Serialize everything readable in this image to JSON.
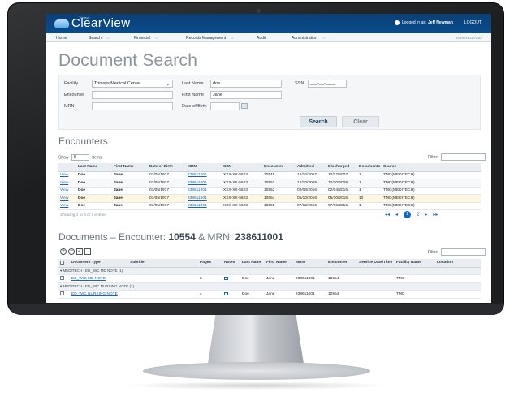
{
  "app": {
    "brand_sub": "Trinisys",
    "brand_name": "ClearView",
    "logged_in_label": "Logged in as:",
    "user_name": "Jeff Newman",
    "logout_label": "LOGOUT",
    "release": "2019 RELEASE"
  },
  "menu": [
    "Home",
    "Search",
    "Financial",
    "Records Management",
    "Audit",
    "Administration"
  ],
  "page": {
    "title": "Document Search"
  },
  "search_form": {
    "facility_label": "Facility",
    "facility_value": "Trinisys Medical Center",
    "encounter_label": "Encounter",
    "mrn_label": "MRN",
    "last_name_label": "Last Name",
    "last_name_value": "doe",
    "first_name_label": "First Name",
    "first_name_value": "Jane",
    "dob_label": "Date of Birth",
    "ssn_label": "SSN",
    "ssn_value": "___-__-____",
    "search_button": "Search",
    "clear_button": "Clear"
  },
  "encounters": {
    "title": "Encounters",
    "show_label": "Show",
    "show_value": "5",
    "items_label": "Items",
    "filter_label": "Filter:",
    "columns": [
      "",
      "Last Name",
      "First Name",
      "Date of Birth",
      "MRN",
      "SSN",
      "Encounter",
      "Admitted",
      "Discharged",
      "Documents",
      "Source"
    ],
    "rows": [
      [
        "View",
        "Doe",
        "Jane",
        "07/05/1977",
        "238611001",
        "XXX-XX-5623",
        "10549",
        "12/12/2007",
        "12/12/2007",
        "1",
        "TMC(MEDITECH)"
      ],
      [
        "View",
        "Doe",
        "Jane",
        "07/05/1977",
        "238611001",
        "XXX-XX-5623",
        "10551",
        "12/10/2009",
        "12/10/2009",
        "1",
        "TMC(MEDITECH)"
      ],
      [
        "View",
        "Doe",
        "Jane",
        "07/05/1977",
        "238611001",
        "XXX-XX-5623",
        "10552",
        "02/04/2016",
        "02/04/2016",
        "1",
        "TMC(MEDITECH)"
      ],
      [
        "View",
        "Doe",
        "Jane",
        "07/05/1977",
        "238611001",
        "XXX-XX-5623",
        "10554",
        "05/10/2016",
        "05/10/2016",
        "10",
        "TMC(MEDITECH)"
      ],
      [
        "View",
        "Doe",
        "Jane",
        "07/05/1977",
        "238611001",
        "XXX-XX-5623",
        "10555",
        "07/15/2016",
        "07/15/2016",
        "1",
        "TMC(MEDITECH)"
      ]
    ],
    "showing": "Showing 1 to 5 of 7 entries",
    "pager": {
      "first": "◂◂",
      "prev": "◂",
      "page1": "1",
      "page2": "2",
      "next": "▸",
      "last": "▸▸"
    }
  },
  "documents": {
    "title_prefix": "Documents – Encounter:",
    "encounter": "10554",
    "mrn_prefix": "& MRN:",
    "mrn": "238611001",
    "filter_label": "Filter:",
    "columns": [
      "",
      "Document Type",
      "Subtitle",
      "Pages",
      "Notes",
      "Last Name",
      "First Name",
      "MRN",
      "Encounter",
      "Service Date/Time",
      "Facility Name",
      "Location"
    ],
    "groups": [
      {
        "label": "MEDITECH - ED_WIC MD NOTE (1)",
        "row": [
          "",
          "ED_WIC MD NOTE",
          "",
          "6",
          "",
          "Doe",
          "Jane",
          "238611001",
          "10554",
          "",
          "TMC",
          ""
        ]
      },
      {
        "label": "MEDITECH - ED_WIC NURSING NOTE (1)",
        "row": [
          "",
          "ED_WIC NURSING NOTE",
          "",
          "4",
          "",
          "Doe",
          "Jane",
          "238611001",
          "10554",
          "",
          "TMC",
          ""
        ]
      }
    ]
  },
  "colors": {
    "topbar": "#0a4c8c",
    "link": "#1565c0",
    "title": "#8a949c"
  }
}
